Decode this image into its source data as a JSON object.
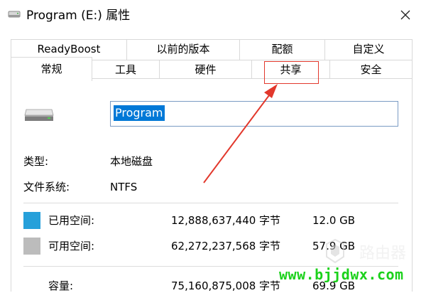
{
  "window": {
    "title": "Program (E:) 属性",
    "icons": {
      "title": "drive-icon",
      "close": "close-icon"
    }
  },
  "tabs": {
    "row1": [
      "ReadyBoost",
      "以前的版本",
      "配额",
      "自定义"
    ],
    "row2": [
      "常规",
      "工具",
      "硬件",
      "共享",
      "安全"
    ],
    "active": "常规",
    "highlighted": "共享"
  },
  "general": {
    "drive_name": "Program",
    "type_label": "类型:",
    "type_value": "本地磁盘",
    "fs_label": "文件系统:",
    "fs_value": "NTFS",
    "used": {
      "label": "已用空间:",
      "bytes": "12,888,637,440 字节",
      "size": "12.0 GB",
      "color": "#26a0da"
    },
    "free": {
      "label": "可用空间:",
      "bytes": "62,272,237,568 字节",
      "size": "57.9 GB",
      "color": "#bcbcbc"
    },
    "capacity": {
      "label": "容量:",
      "bytes": "75,160,875,008 字节",
      "size": "69.9 GB"
    }
  },
  "annotation": {
    "color": "#e2382c"
  },
  "watermark": {
    "logo_text": "路由器",
    "url": "www.bjjdwx.com",
    "url_color": "#1bd11b"
  }
}
